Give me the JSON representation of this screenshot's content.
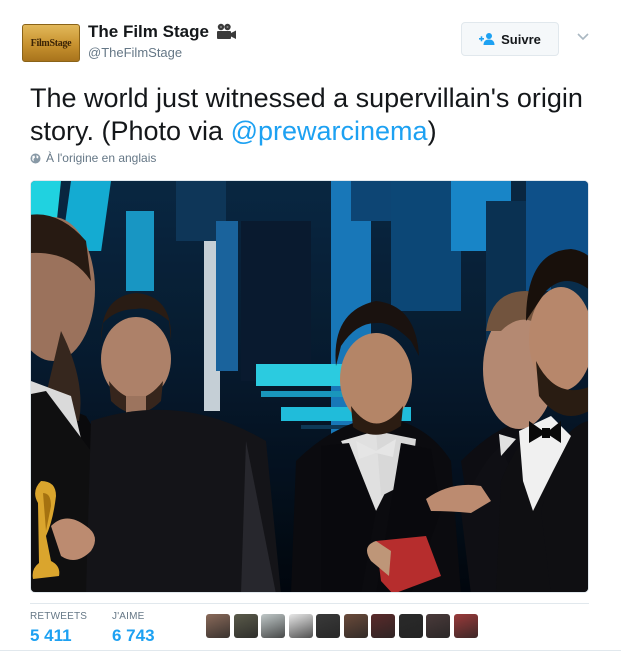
{
  "author": {
    "display_name": "The Film Stage",
    "handle": "@TheFilmStage",
    "avatar_text": "FilmStage"
  },
  "follow_button": {
    "label": "Suivre"
  },
  "tweet": {
    "text_before": "The world just witnessed a supervillain's origin story. (Photo via ",
    "mention": "@prewarcinema",
    "text_after": ")",
    "translation_note": "À l'origine en anglais"
  },
  "stats": {
    "retweets_label": "RETWEETS",
    "retweets_value": "5 411",
    "likes_label": "J'AIME",
    "likes_value": "6 743"
  },
  "likers": [
    {
      "color": "#8a6a5a"
    },
    {
      "color": "#5a5a4a"
    },
    {
      "color": "#c0c8c8"
    },
    {
      "color": "#e8e8e8"
    },
    {
      "color": "#3a3a3a"
    },
    {
      "color": "#6a4a3a"
    },
    {
      "color": "#5a2a2a"
    },
    {
      "color": "#2a2a2a"
    },
    {
      "color": "#4a3a3a"
    },
    {
      "color": "#9a3a3a"
    }
  ],
  "colors": {
    "accent": "#1da1f2",
    "secondary_text": "#657786",
    "border": "#e1e8ed"
  }
}
